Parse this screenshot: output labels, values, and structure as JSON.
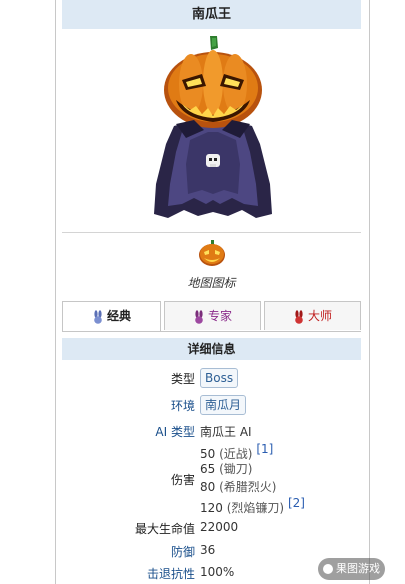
{
  "title": "南瓜王",
  "map_icon_caption": "地图图标",
  "tabs": [
    {
      "label": "经典",
      "active": true,
      "icon": "bunny-icon"
    },
    {
      "label": "专家",
      "active": false,
      "icon": "purple-bunny-icon"
    },
    {
      "label": "大师",
      "active": false,
      "icon": "red-bunny-icon"
    }
  ],
  "details_header": "详细信息",
  "stats": {
    "type_label": "类型",
    "type_value": "Boss",
    "env_label": "环境",
    "env_value": "南瓜月",
    "ai_label": "AI 类型",
    "ai_value": "南瓜王 AI",
    "damage_label": "伤害",
    "damage": [
      {
        "value": "50",
        "note": "(近战)",
        "ref": "[1]"
      },
      {
        "value": "65",
        "note": "(锄刀)",
        "ref": ""
      },
      {
        "value": "80",
        "note": "(希腊烈火)",
        "ref": ""
      },
      {
        "value": "120",
        "note": "(烈焰镰刀)",
        "ref": "[2]"
      }
    ],
    "max_life_label": "最大生命值",
    "max_life_value": "22000",
    "defense_label": "防御",
    "defense_value": "36",
    "knockback_label": "击退抗性",
    "knockback_value": "100%"
  },
  "watermark": "果图游戏",
  "colors": {
    "header_bg": "#dde9f4",
    "link": "#1a4f8b",
    "expert": "#8b2c8b",
    "master": "#c02020"
  }
}
